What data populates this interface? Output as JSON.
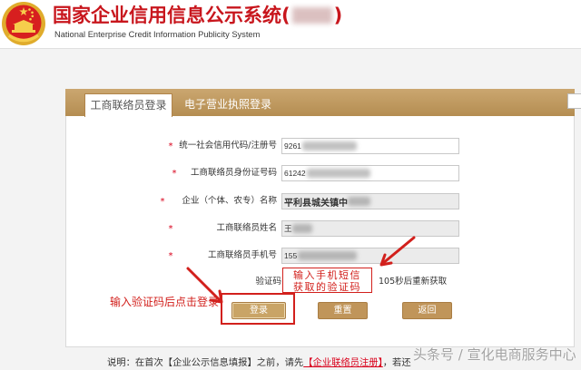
{
  "header": {
    "emblem_icon": "national-emblem",
    "title_prefix": "国家企业信用信息公示系统(",
    "title_suffix": ")",
    "subtitle": "National Enterprise Credit Information Publicity System"
  },
  "tabs": [
    {
      "label": "工商联络员登录",
      "active": true
    },
    {
      "label": "电子营业执照登录",
      "active": false
    }
  ],
  "form": {
    "required_mark": "*",
    "fields": [
      {
        "label": "统一社会信用代码/注册号",
        "value": "9261",
        "readonly": false
      },
      {
        "label": "工商联络员身份证号码",
        "value": "61242",
        "readonly": false
      },
      {
        "label": "企业（个体、农专）名称",
        "value": "平利县城关镇中",
        "readonly": true
      },
      {
        "label": "工商联络员姓名",
        "value": "王",
        "readonly": true
      },
      {
        "label": "工商联络员手机号",
        "value": "155",
        "readonly": true
      }
    ],
    "captcha": {
      "label": "验证码",
      "countdown": "105秒后重新获取"
    }
  },
  "buttons": {
    "login": "登录",
    "reset": "重置",
    "back": "返回"
  },
  "annotations": {
    "captcha_hint": [
      "输入手机短信",
      "获取的验证码"
    ],
    "login_hint": "输入验证码后点击登录"
  },
  "footer": {
    "note_prefix": "说明：在首次【企业公示信息填报】之前，请先",
    "note_link": "【企业联络员注册】",
    "note_suffix": "，若还"
  },
  "watermark": "头条号 / 宣化电商服务中心",
  "colors": {
    "title_red": "#c8161d",
    "tab_bar": "#c29858",
    "button": "#c0955a",
    "required_red": "#d9001b",
    "annotation_red": "#d2201c",
    "readonly_bg": "#ebebeb"
  }
}
